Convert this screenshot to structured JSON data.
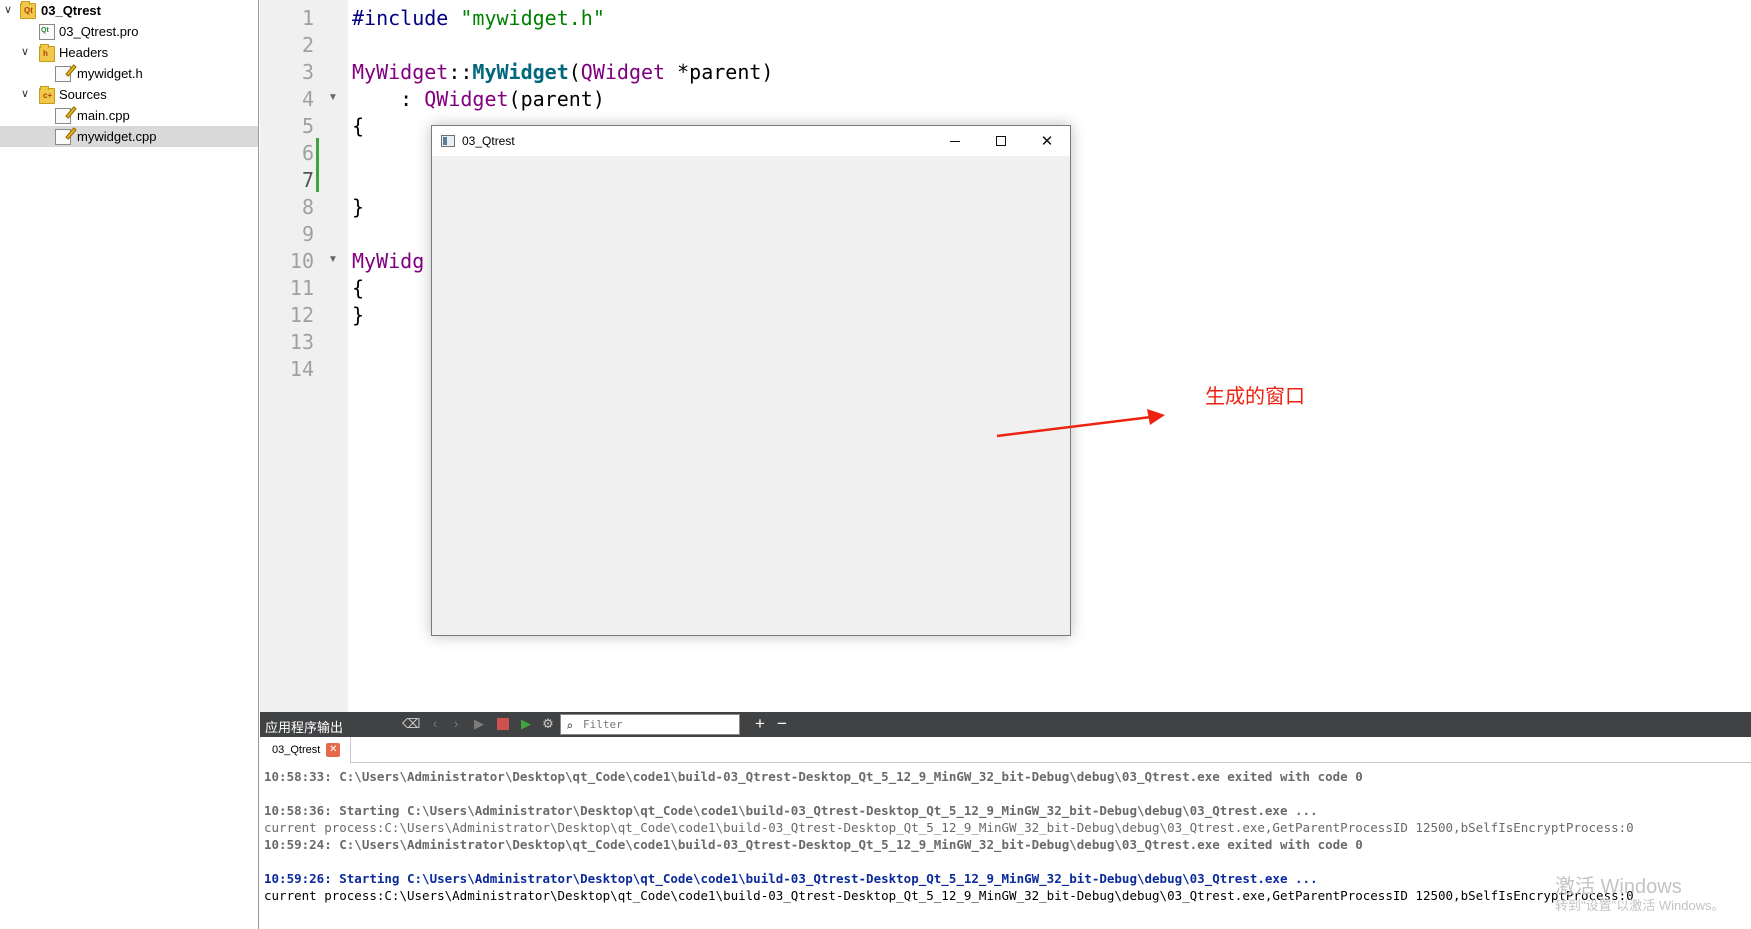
{
  "tree": {
    "project": "03_Qtrest",
    "pro_file": "03_Qtrest.pro",
    "headers_folder": "Headers",
    "header_file": "mywidget.h",
    "sources_folder": "Sources",
    "source_files": [
      "main.cpp",
      "mywidget.cpp"
    ],
    "selected": "mywidget.cpp",
    "expand_arrow": "∨"
  },
  "editor": {
    "line_numbers": [
      "1",
      "2",
      "3",
      "4",
      "5",
      "6",
      "7",
      "8",
      "9",
      "10",
      "11",
      "12",
      "13",
      "14"
    ],
    "current_line": "7",
    "lines": {
      "l1_pp": "#include ",
      "l1_str": "\"mywidget.h\"",
      "l3_cls1": "MyWidget",
      "l3_sep": "::",
      "l3_fn": "MyWidget",
      "l3_open": "(",
      "l3_cls2": "QWidget",
      "l3_rest": " *parent)",
      "l4_colon": "    : ",
      "l4_cls": "QWidget",
      "l4_rest": "(parent)",
      "l5": "{",
      "l8": "}",
      "l10_cls": "MyWidg",
      "l11": "{",
      "l12": "}"
    }
  },
  "window": {
    "title": "03_Qtrest",
    "minimize_glyph": "—",
    "close_glyph": "✕"
  },
  "annotation": {
    "text": "生成的窗口",
    "color": "#ee2211"
  },
  "output": {
    "panel_title": "应用程序输出",
    "filter_placeholder": "Filter",
    "tab_label": "03_Qtrest",
    "tab_close": "✕",
    "plus": "+",
    "minus": "−",
    "log": [
      {
        "style": "graybold",
        "text": "10:58:33: C:\\Users\\Administrator\\Desktop\\qt_Code\\code1\\build-03_Qtrest-Desktop_Qt_5_12_9_MinGW_32_bit-Debug\\debug\\03_Qtrest.exe exited with code 0"
      },
      {
        "style": "graybold",
        "text": "10:58:36: Starting C:\\Users\\Administrator\\Desktop\\qt_Code\\code1\\build-03_Qtrest-Desktop_Qt_5_12_9_MinGW_32_bit-Debug\\debug\\03_Qtrest.exe ..."
      },
      {
        "style": "gray",
        "text": "current process:C:\\Users\\Administrator\\Desktop\\qt_Code\\code1\\build-03_Qtrest-Desktop_Qt_5_12_9_MinGW_32_bit-Debug\\debug\\03_Qtrest.exe,GetParentProcessID 12500,bSelfIsEncryptProcess:0"
      },
      {
        "style": "graybold",
        "text": "10:59:24: C:\\Users\\Administrator\\Desktop\\qt_Code\\code1\\build-03_Qtrest-Desktop_Qt_5_12_9_MinGW_32_bit-Debug\\debug\\03_Qtrest.exe exited with code 0"
      },
      {
        "style": "bluebold",
        "text": "10:59:26: Starting C:\\Users\\Administrator\\Desktop\\qt_Code\\code1\\build-03_Qtrest-Desktop_Qt_5_12_9_MinGW_32_bit-Debug\\debug\\03_Qtrest.exe ..."
      },
      {
        "style": "black",
        "text": "current process:C:\\Users\\Administrator\\Desktop\\qt_Code\\code1\\build-03_Qtrest-Desktop_Qt_5_12_9_MinGW_32_bit-Debug\\debug\\03_Qtrest.exe,GetParentProcessID 12500,bSelfIsEncryptProcess:0"
      }
    ]
  },
  "watermark": {
    "line1": "激活 Windows",
    "line2": "转到\"设置\"以激活 Windows。"
  }
}
